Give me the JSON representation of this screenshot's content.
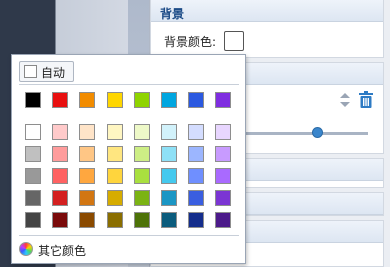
{
  "panel": {
    "background_section": {
      "title": "背景",
      "bg_color_label": "背景颜色:"
    }
  },
  "picker": {
    "auto_label": "自动",
    "more_colors_label": "其它颜色",
    "standard_colors": [
      "#000000",
      "#e81010",
      "#f28c00",
      "#ffd600",
      "#8fd400",
      "#00a6e0",
      "#2b59e0",
      "#7f2de0"
    ],
    "palette": [
      [
        "#ffffff",
        "#ffcaca",
        "#ffe4c8",
        "#fff6c2",
        "#eef9c8",
        "#d2f2fb",
        "#d4ddff",
        "#e8d6ff"
      ],
      [
        "#c0c0c0",
        "#ff9c9c",
        "#ffc685",
        "#ffe680",
        "#cdee85",
        "#8ee0f6",
        "#9cb6ff",
        "#c89bff"
      ],
      [
        "#999999",
        "#ff6262",
        "#ffa73f",
        "#ffd53d",
        "#a9e03f",
        "#45c9ee",
        "#6f8fff",
        "#a96aff"
      ],
      [
        "#666666",
        "#d42020",
        "#d27612",
        "#d6ac00",
        "#7bb314",
        "#1b96c4",
        "#3a5ee0",
        "#7b35d3"
      ],
      [
        "#444444",
        "#7a0a0a",
        "#8a4a00",
        "#8a6e00",
        "#4d7208",
        "#0b5c7d",
        "#142d8c",
        "#4c1a8a"
      ]
    ]
  }
}
